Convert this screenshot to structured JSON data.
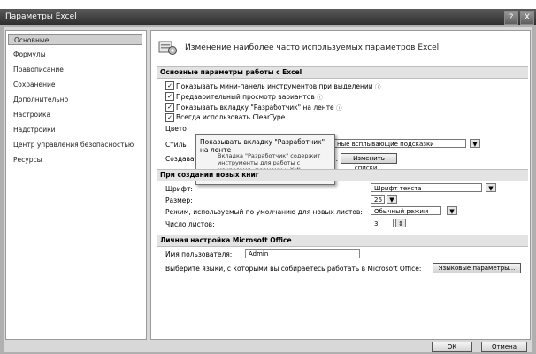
{
  "window": {
    "title": "Параметры Excel",
    "help": "?",
    "close": "X"
  },
  "nav": {
    "items": [
      {
        "label": "Основные",
        "selected": true
      },
      {
        "label": "Формулы"
      },
      {
        "label": "Правописание"
      },
      {
        "label": "Сохранение"
      },
      {
        "label": "Дополнительно"
      },
      {
        "label": "Настройка"
      },
      {
        "label": "Надстройки"
      },
      {
        "label": "Центр управления безопасностью"
      },
      {
        "label": "Ресурсы"
      }
    ]
  },
  "header": {
    "text": "Изменение наиболее часто используемых параметров Excel."
  },
  "section_main": {
    "title": "Основные параметры работы с Excel",
    "options": [
      {
        "label": "Показывать мини-панель инструментов при выделении",
        "checked": true
      },
      {
        "label": "Предварительный просмотр вариантов",
        "checked": true
      },
      {
        "label": "Показывать вкладку \"Разработчик\" на ленте",
        "checked": true
      },
      {
        "label": "Всегда использовать ClearType",
        "checked": true
      }
    ],
    "color_scheme_label": "Цвето",
    "tip_style_label": "Стиль",
    "tip_style_value": "ные всплывающие подсказки",
    "create_lists_label": "Создавать списки для сортировки и заполнения:",
    "edit_lists_button": "Изменить списки..."
  },
  "tooltip": {
    "title": "Показывать вкладку \"Разработчик\" на ленте",
    "body": "Вкладка \"Разработчик\" содержит инструменты для работы с макросами, формами и XML-файлами."
  },
  "section_new": {
    "title": "При создании новых книг",
    "font_label": "Шрифт:",
    "font_value": "Шрифт текста",
    "size_label": "Размер:",
    "size_value": "26",
    "view_label": "Режим, используемый по умолчанию для новых листов:",
    "view_value": "Обычный режим",
    "sheets_label": "Число листов:",
    "sheets_value": "3"
  },
  "section_personal": {
    "title": "Личная настройка Microsoft Office",
    "user_label": "Имя пользователя:",
    "user_value": "Admin",
    "lang_label": "Выберите языки, с которыми вы собираетесь работать в Microsoft Office:",
    "lang_button": "Языковые параметры..."
  },
  "footer": {
    "ok": "ОК",
    "cancel": "Отмена"
  },
  "icons": {
    "info": "ⓘ",
    "dropdown": "▼",
    "spin": "⇕",
    "check": "✓"
  }
}
